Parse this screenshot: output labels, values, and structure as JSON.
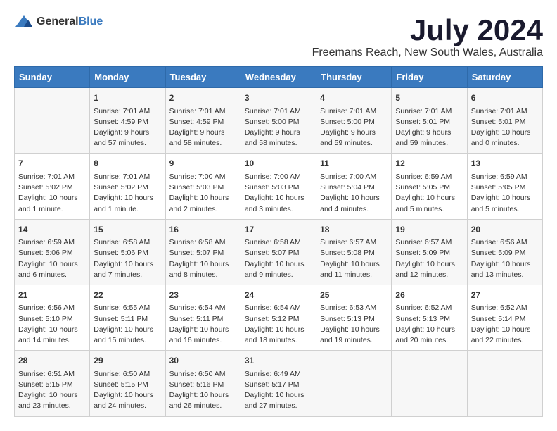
{
  "logo": {
    "general": "General",
    "blue": "Blue"
  },
  "title": "July 2024",
  "subtitle": "Freemans Reach, New South Wales, Australia",
  "days_of_week": [
    "Sunday",
    "Monday",
    "Tuesday",
    "Wednesday",
    "Thursday",
    "Friday",
    "Saturday"
  ],
  "weeks": [
    [
      {
        "day": "",
        "content": ""
      },
      {
        "day": "1",
        "content": "Sunrise: 7:01 AM\nSunset: 4:59 PM\nDaylight: 9 hours\nand 57 minutes."
      },
      {
        "day": "2",
        "content": "Sunrise: 7:01 AM\nSunset: 4:59 PM\nDaylight: 9 hours\nand 58 minutes."
      },
      {
        "day": "3",
        "content": "Sunrise: 7:01 AM\nSunset: 5:00 PM\nDaylight: 9 hours\nand 58 minutes."
      },
      {
        "day": "4",
        "content": "Sunrise: 7:01 AM\nSunset: 5:00 PM\nDaylight: 9 hours\nand 59 minutes."
      },
      {
        "day": "5",
        "content": "Sunrise: 7:01 AM\nSunset: 5:01 PM\nDaylight: 9 hours\nand 59 minutes."
      },
      {
        "day": "6",
        "content": "Sunrise: 7:01 AM\nSunset: 5:01 PM\nDaylight: 10 hours\nand 0 minutes."
      }
    ],
    [
      {
        "day": "7",
        "content": "Sunrise: 7:01 AM\nSunset: 5:02 PM\nDaylight: 10 hours\nand 1 minute."
      },
      {
        "day": "8",
        "content": "Sunrise: 7:01 AM\nSunset: 5:02 PM\nDaylight: 10 hours\nand 1 minute."
      },
      {
        "day": "9",
        "content": "Sunrise: 7:00 AM\nSunset: 5:03 PM\nDaylight: 10 hours\nand 2 minutes."
      },
      {
        "day": "10",
        "content": "Sunrise: 7:00 AM\nSunset: 5:03 PM\nDaylight: 10 hours\nand 3 minutes."
      },
      {
        "day": "11",
        "content": "Sunrise: 7:00 AM\nSunset: 5:04 PM\nDaylight: 10 hours\nand 4 minutes."
      },
      {
        "day": "12",
        "content": "Sunrise: 6:59 AM\nSunset: 5:05 PM\nDaylight: 10 hours\nand 5 minutes."
      },
      {
        "day": "13",
        "content": "Sunrise: 6:59 AM\nSunset: 5:05 PM\nDaylight: 10 hours\nand 5 minutes."
      }
    ],
    [
      {
        "day": "14",
        "content": "Sunrise: 6:59 AM\nSunset: 5:06 PM\nDaylight: 10 hours\nand 6 minutes."
      },
      {
        "day": "15",
        "content": "Sunrise: 6:58 AM\nSunset: 5:06 PM\nDaylight: 10 hours\nand 7 minutes."
      },
      {
        "day": "16",
        "content": "Sunrise: 6:58 AM\nSunset: 5:07 PM\nDaylight: 10 hours\nand 8 minutes."
      },
      {
        "day": "17",
        "content": "Sunrise: 6:58 AM\nSunset: 5:07 PM\nDaylight: 10 hours\nand 9 minutes."
      },
      {
        "day": "18",
        "content": "Sunrise: 6:57 AM\nSunset: 5:08 PM\nDaylight: 10 hours\nand 11 minutes."
      },
      {
        "day": "19",
        "content": "Sunrise: 6:57 AM\nSunset: 5:09 PM\nDaylight: 10 hours\nand 12 minutes."
      },
      {
        "day": "20",
        "content": "Sunrise: 6:56 AM\nSunset: 5:09 PM\nDaylight: 10 hours\nand 13 minutes."
      }
    ],
    [
      {
        "day": "21",
        "content": "Sunrise: 6:56 AM\nSunset: 5:10 PM\nDaylight: 10 hours\nand 14 minutes."
      },
      {
        "day": "22",
        "content": "Sunrise: 6:55 AM\nSunset: 5:11 PM\nDaylight: 10 hours\nand 15 minutes."
      },
      {
        "day": "23",
        "content": "Sunrise: 6:54 AM\nSunset: 5:11 PM\nDaylight: 10 hours\nand 16 minutes."
      },
      {
        "day": "24",
        "content": "Sunrise: 6:54 AM\nSunset: 5:12 PM\nDaylight: 10 hours\nand 18 minutes."
      },
      {
        "day": "25",
        "content": "Sunrise: 6:53 AM\nSunset: 5:13 PM\nDaylight: 10 hours\nand 19 minutes."
      },
      {
        "day": "26",
        "content": "Sunrise: 6:52 AM\nSunset: 5:13 PM\nDaylight: 10 hours\nand 20 minutes."
      },
      {
        "day": "27",
        "content": "Sunrise: 6:52 AM\nSunset: 5:14 PM\nDaylight: 10 hours\nand 22 minutes."
      }
    ],
    [
      {
        "day": "28",
        "content": "Sunrise: 6:51 AM\nSunset: 5:15 PM\nDaylight: 10 hours\nand 23 minutes."
      },
      {
        "day": "29",
        "content": "Sunrise: 6:50 AM\nSunset: 5:15 PM\nDaylight: 10 hours\nand 24 minutes."
      },
      {
        "day": "30",
        "content": "Sunrise: 6:50 AM\nSunset: 5:16 PM\nDaylight: 10 hours\nand 26 minutes."
      },
      {
        "day": "31",
        "content": "Sunrise: 6:49 AM\nSunset: 5:17 PM\nDaylight: 10 hours\nand 27 minutes."
      },
      {
        "day": "",
        "content": ""
      },
      {
        "day": "",
        "content": ""
      },
      {
        "day": "",
        "content": ""
      }
    ]
  ]
}
